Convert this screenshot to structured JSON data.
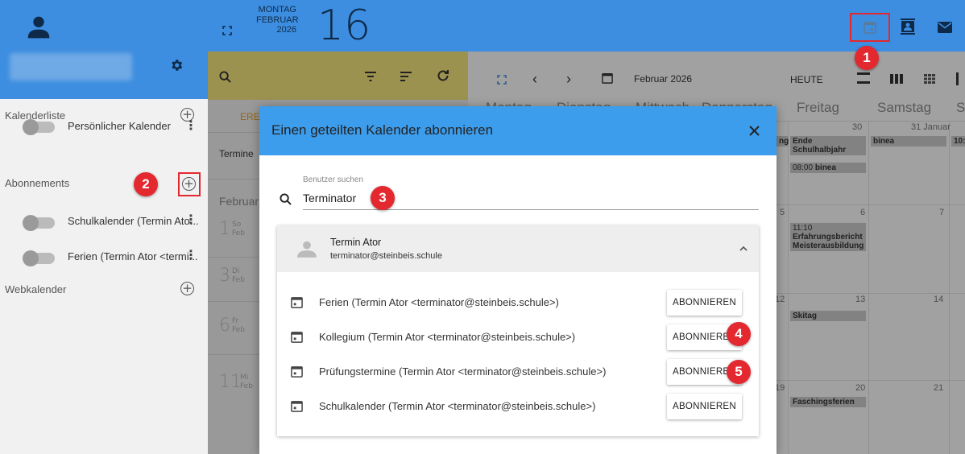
{
  "topbar": {
    "weekday": "MONTAG",
    "month": "FEBRUAR",
    "year": "2026",
    "day": "16"
  },
  "sidebar": {
    "calendar_list_label": "Kalenderliste",
    "personal_calendar": "Persönlicher Kalender",
    "subscriptions_label": "Abonnements",
    "subscriptions": [
      "Schulkalender (Termin Ato...",
      "Ferien (Termin Ator <termi..."
    ],
    "webcal_label": "Webkalender"
  },
  "middle": {
    "tab_label": "EREI",
    "termine_label": "Termine",
    "month_label": "Februar",
    "dates": [
      {
        "num": "1",
        "day": "So",
        "month": "Feb"
      },
      {
        "num": "3",
        "day": "Di",
        "month": "Feb"
      },
      {
        "num": "6",
        "day": "Fr",
        "month": "Feb"
      },
      {
        "num": "11",
        "day": "Mi",
        "month": "Feb"
      }
    ]
  },
  "calendar": {
    "month_title": "Februar 2026",
    "today_button": "HEUTE",
    "day_headers": [
      "Montag",
      "Dienstag",
      "Mittwoch",
      "Donnerstag",
      "Freitag",
      "Samstag",
      "S"
    ],
    "week_row1": {
      "fri_num": "30",
      "sat_num": "31 Januar"
    },
    "events": {
      "ende": "Ende Schulhalbjahr",
      "ende_prefix": "ng",
      "binea_time": "08:00",
      "binea": "binea",
      "binea_sat": "binea",
      "sun_prefix": "10:1",
      "num5": "5",
      "num6": "6",
      "num7": "7",
      "erf_time": "11:10",
      "erf": "Erfahrungsbericht Meisterausbildung",
      "num12": "12",
      "num13": "13",
      "num14": "14",
      "skitag": "Skitag",
      "num19": "19",
      "num20": "20",
      "num21": "21",
      "fasching": "Faschingsferien"
    }
  },
  "dialog": {
    "title": "Einen geteilten Kalender abonnieren",
    "search_label": "Benutzer suchen",
    "search_value": "Terminator",
    "user_name": "Termin Ator",
    "user_email": "terminator@steinbeis.schule",
    "calendars": [
      {
        "name": "Ferien (Termin Ator <terminator@steinbeis.schule>)",
        "button": "ABONNIEREN"
      },
      {
        "name": "Kollegium (Termin Ator <terminator@steinbeis.schule>)",
        "button": "ABONNIEREN"
      },
      {
        "name": "Prüfungstermine (Termin Ator <terminator@steinbeis.schule>)",
        "button": "ABONNIEREN"
      },
      {
        "name": "Schulkalender (Termin Ator <terminator@steinbeis.schule>)",
        "button": "ABONNIEREN"
      }
    ]
  },
  "callouts": [
    "1",
    "2",
    "3",
    "4",
    "5"
  ],
  "colors": {
    "primary": "#3d8ee0",
    "dialog_header": "#3d9ded",
    "search_bar": "#efe17a",
    "callout": "#e3282f"
  }
}
